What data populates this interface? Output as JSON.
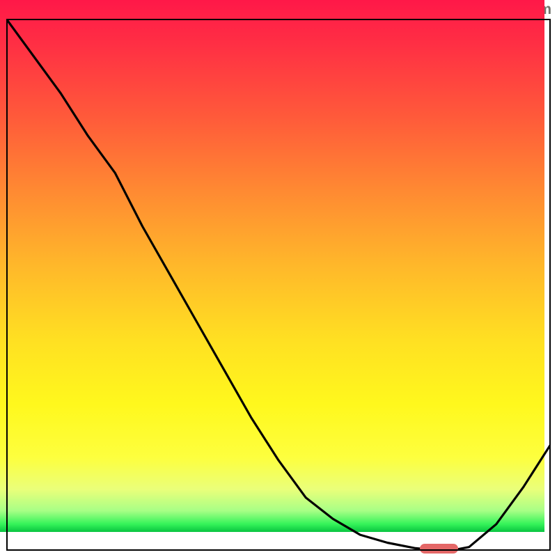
{
  "watermark": "TheBottleneck.com",
  "chart_data": {
    "type": "line",
    "x": [
      0.0,
      0.05,
      0.1,
      0.15,
      0.2,
      0.25,
      0.3,
      0.35,
      0.4,
      0.45,
      0.5,
      0.55,
      0.6,
      0.65,
      0.7,
      0.75,
      0.78,
      0.8,
      0.83,
      0.85,
      0.9,
      0.95,
      1.0
    ],
    "values": [
      1.0,
      0.93,
      0.86,
      0.78,
      0.71,
      0.61,
      0.52,
      0.43,
      0.34,
      0.25,
      0.17,
      0.1,
      0.06,
      0.03,
      0.015,
      0.005,
      0.002,
      0.002,
      0.003,
      0.007,
      0.05,
      0.12,
      0.2
    ],
    "title": "",
    "xlabel": "",
    "ylabel": "",
    "xlim": [
      0,
      1
    ],
    "ylim": [
      0,
      1
    ],
    "marker": {
      "x_start": 0.76,
      "x_end": 0.83,
      "y": 0.004
    }
  },
  "colors": {
    "curve": "#000000",
    "marker": "#e46767",
    "border": "#000000",
    "watermark": "#72746d"
  }
}
